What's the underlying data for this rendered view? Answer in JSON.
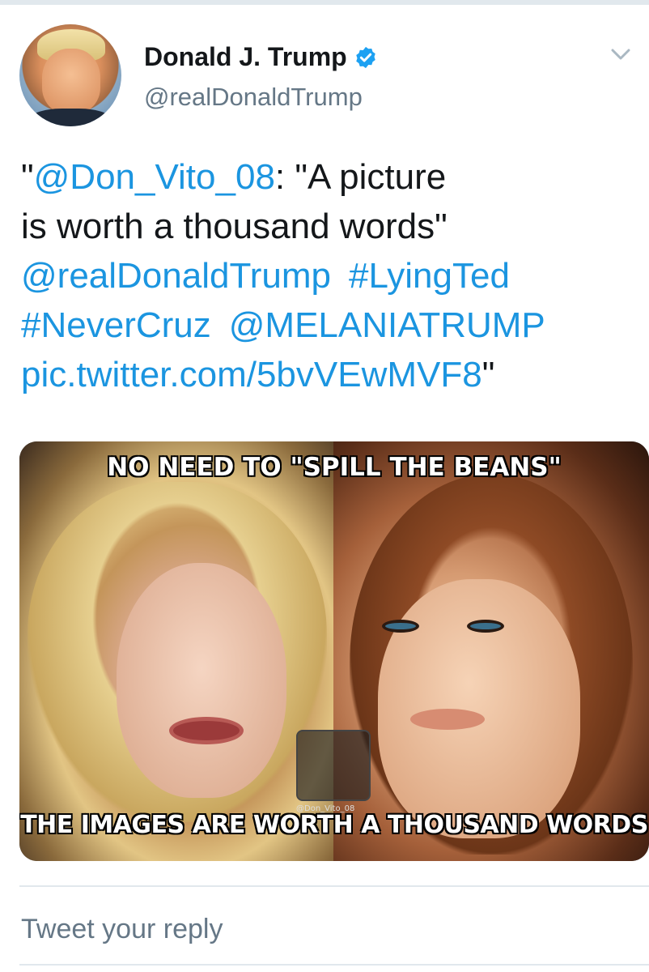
{
  "author": {
    "display_name": "Donald J. Trump",
    "handle": "@realDonaldTrump",
    "verified": true,
    "avatar": "profile-photo"
  },
  "tweet": {
    "open_quote": "\"",
    "mention_don_vito": "@Don_Vito_08",
    "line1_rest": ": \"A picture",
    "line2": "is worth a thousand words\"",
    "mention_realdonaldtrump": "@realDonaldTrump",
    "hashtag_lyingted": "#LyingTed",
    "hashtag_nevercruz": "#NeverCruz",
    "mention_melania": "@MELANIATRUMP",
    "pic_link": "pic.twitter.com/5bvVEwMVF8",
    "close_quote": "\""
  },
  "media": {
    "top_caption": "NO NEED TO \"SPILL THE BEANS\"",
    "bottom_caption": "THE IMAGES ARE WORTH A THOUSAND WORDS",
    "watermark": "@Don_Vito_08"
  },
  "reply": {
    "placeholder": "Tweet your reply"
  },
  "icons": {
    "verified": "verified-badge-icon",
    "menu": "chevron-down-icon"
  },
  "colors": {
    "link": "#1b95e0",
    "secondary_text": "#657786",
    "primary_text": "#14171a",
    "divider": "#e1e8ed"
  }
}
